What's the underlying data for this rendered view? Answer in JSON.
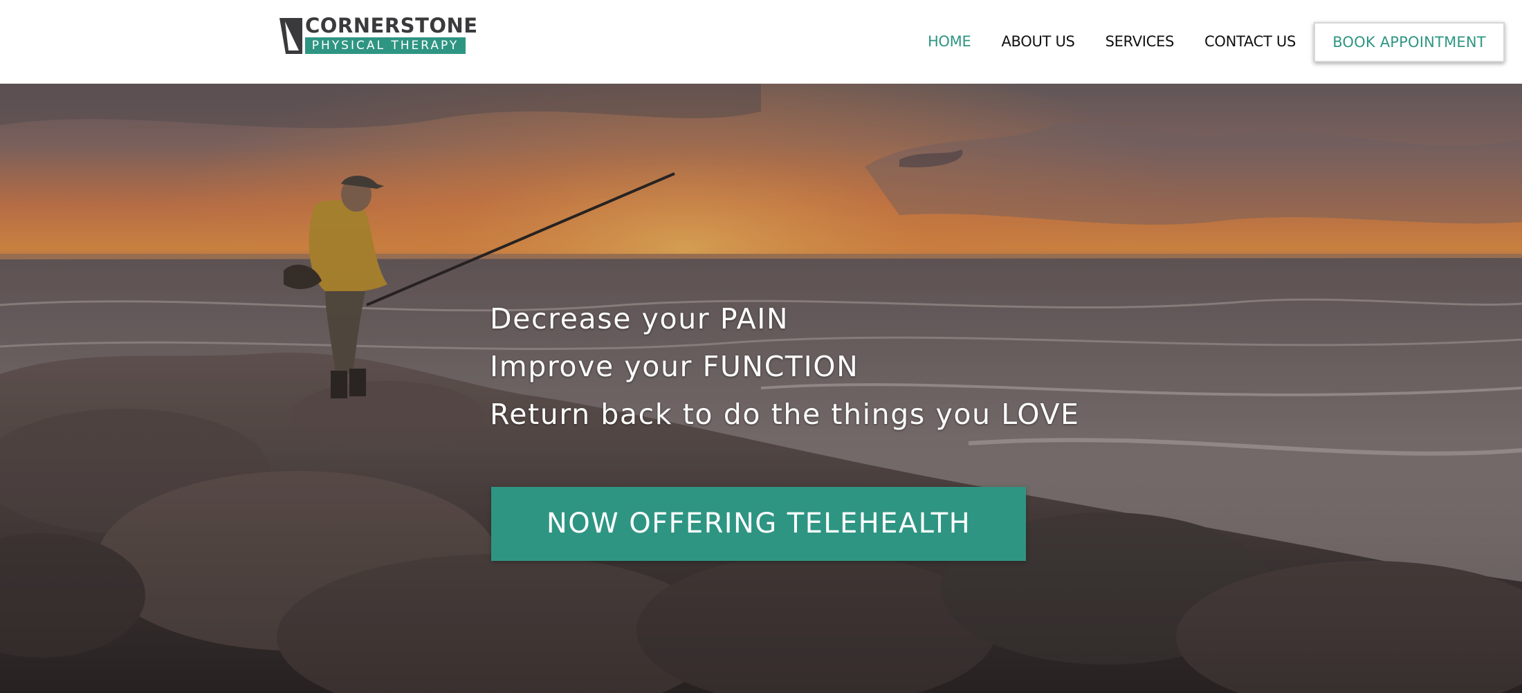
{
  "colors": {
    "brand_teal": "#2f9583",
    "nav_text": "#111111",
    "logo_dark": "#3a3a3c",
    "hero_text": "#ffffff"
  },
  "header": {
    "logo": {
      "name": "CORNERSTONE",
      "subtitle": "PHYSICAL THERAPY",
      "icon": "cornerstone-logo-icon"
    },
    "nav": {
      "items": [
        {
          "label": "HOME",
          "active": true
        },
        {
          "label": "ABOUT US",
          "active": false
        },
        {
          "label": "SERVICES",
          "active": false
        },
        {
          "label": "CONTACT US",
          "active": false
        }
      ],
      "cta_label": "BOOK APPOINTMENT"
    }
  },
  "hero": {
    "image": "fisherman-on-rocks-at-sunset",
    "lines": [
      "Decrease your PAIN",
      "Improve your FUNCTION",
      "Return back to do the things you LOVE"
    ],
    "cta_label": "NOW OFFERING TELEHEALTH"
  }
}
